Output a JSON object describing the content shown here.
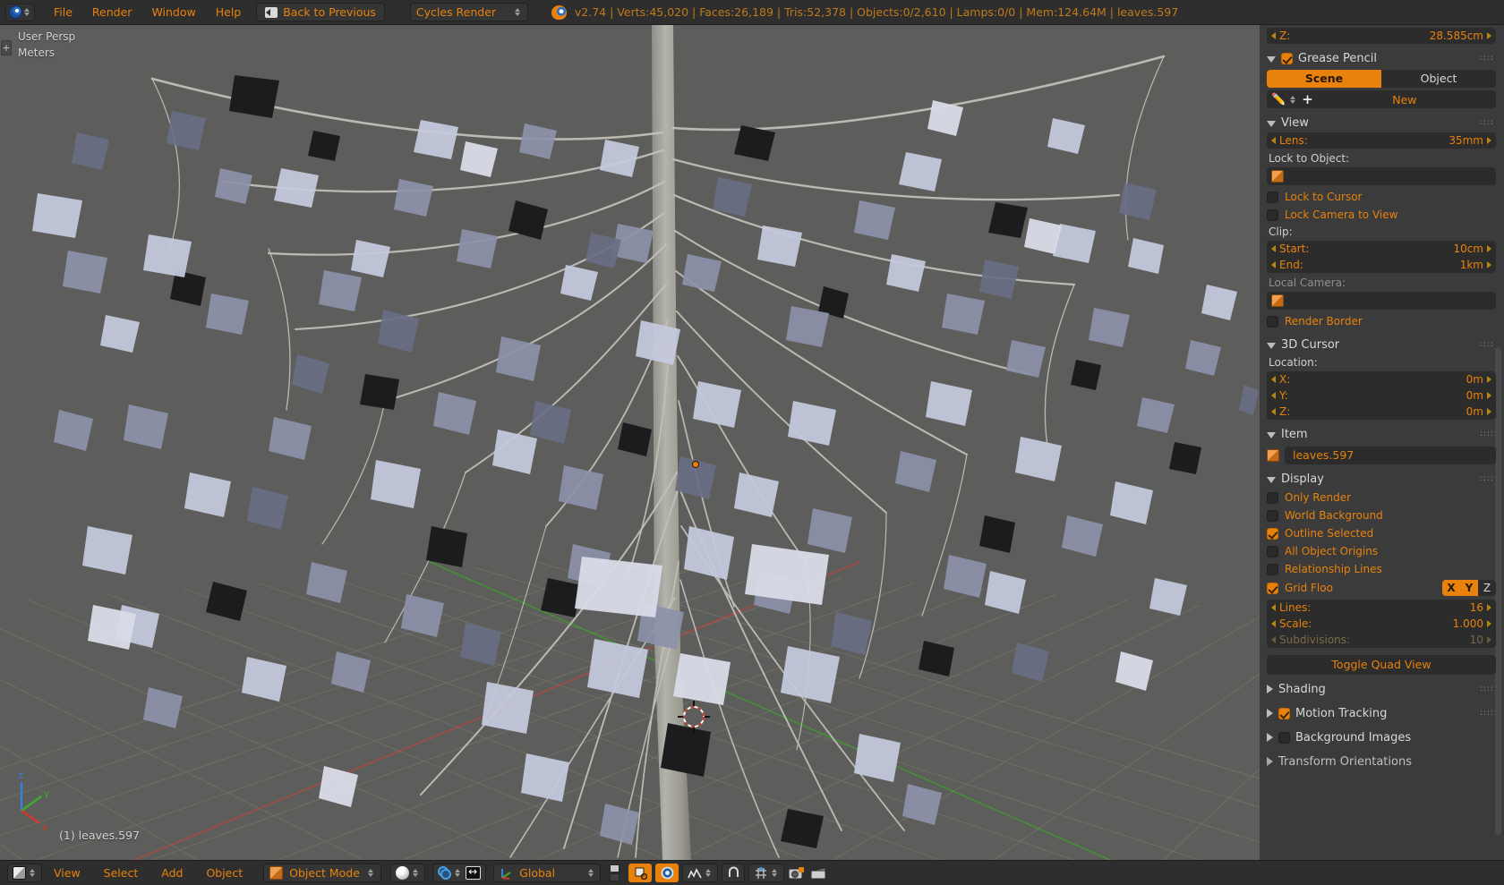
{
  "topbar": {
    "editor_icon": "blender-info-icon",
    "menus": [
      "File",
      "Render",
      "Window",
      "Help"
    ],
    "back_button": "Back to Previous",
    "render_engine": "Cycles Render",
    "stats": "v2.74 | Verts:45,020 | Faces:26,189 | Tris:52,378 | Objects:0/2,610 | Lamps:0/0 | Mem:124.64M | leaves.597",
    "version": "v2.74",
    "verts": "45,020",
    "faces": "26,189",
    "tris": "52,378",
    "objects": "0/2,610",
    "lamps": "0/0",
    "mem": "124.64M",
    "active_object": "leaves.597"
  },
  "viewport": {
    "view_name": "User Persp",
    "units": "Meters",
    "object_label": "(1) leaves.597",
    "axis_labels": {
      "x": "x",
      "y": "y",
      "z": "z"
    },
    "bg_color": "#5d5d5b",
    "grid_color": "#6e6d64",
    "x_axis_color": "#c7453c",
    "y_axis_color": "#4aa832",
    "cursor_color": "#ffffff"
  },
  "sidebar": {
    "transform_z": {
      "label": "Z:",
      "value": "28.585cm"
    },
    "grease_pencil": {
      "title": "Grease Pencil",
      "enabled": true,
      "tabs": [
        "Scene",
        "Object"
      ],
      "active_tab": "Scene",
      "new_button": "New"
    },
    "view": {
      "title": "View",
      "lens": {
        "label": "Lens:",
        "value": "35mm"
      },
      "lock_to_object_label": "Lock to Object:",
      "lock_to_object_value": "",
      "lock_to_cursor": {
        "label": "Lock to Cursor",
        "checked": false
      },
      "lock_camera_to_view": {
        "label": "Lock Camera to View",
        "checked": false
      },
      "clip_label": "Clip:",
      "clip_start": {
        "label": "Start:",
        "value": "10cm"
      },
      "clip_end": {
        "label": "End:",
        "value": "1km"
      },
      "local_camera_label": "Local Camera:",
      "local_camera_value": "",
      "render_border": {
        "label": "Render Border",
        "checked": false
      }
    },
    "cursor": {
      "title": "3D Cursor",
      "location_label": "Location:",
      "x": {
        "label": "X:",
        "value": "0m"
      },
      "y": {
        "label": "Y:",
        "value": "0m"
      },
      "z": {
        "label": "Z:",
        "value": "0m"
      }
    },
    "item": {
      "title": "Item",
      "name": "leaves.597"
    },
    "display": {
      "title": "Display",
      "only_render": {
        "label": "Only Render",
        "checked": false
      },
      "world_background": {
        "label": "World Background",
        "checked": false
      },
      "outline_selected": {
        "label": "Outline Selected",
        "checked": true
      },
      "all_object_origins": {
        "label": "All Object Origins",
        "checked": false
      },
      "relationship_lines": {
        "label": "Relationship Lines",
        "checked": false
      },
      "grid_floor": {
        "label": "Grid Floo",
        "checked": true
      },
      "axis_x": {
        "label": "X",
        "on": true
      },
      "axis_y": {
        "label": "Y",
        "on": true
      },
      "axis_z": {
        "label": "Z",
        "on": false
      },
      "lines": {
        "label": "Lines:",
        "value": "16"
      },
      "scale": {
        "label": "Scale:",
        "value": "1.000"
      },
      "subdivisions": {
        "label": "Subdivisions:",
        "value": "10"
      },
      "toggle_quad_view": "Toggle Quad View"
    },
    "collapsed": [
      {
        "title": "Shading",
        "has_checkbox": false,
        "checked": false
      },
      {
        "title": "Motion Tracking",
        "has_checkbox": true,
        "checked": true
      },
      {
        "title": "Background Images",
        "has_checkbox": true,
        "checked": false
      },
      {
        "title": "Transform Orientations",
        "has_checkbox": false,
        "checked": false
      }
    ]
  },
  "bottombar": {
    "editor_icon": "object-mode-editor-icon",
    "menus": [
      "View",
      "Select",
      "Add",
      "Object"
    ],
    "mode": "Object Mode",
    "shading": "solid-shading-icon",
    "snap": "snap-magnet-icon",
    "pivot": "pivot-center-icon",
    "orientation": "Global",
    "layers": "layer-grid",
    "manipulator_icons": [
      "translate-manipulator-icon",
      "rotate-manipulator-icon"
    ],
    "extra_icons": [
      "curve-icon",
      "snap-during-transform-icon",
      "proportional-edit-icon",
      "render-camera-icon",
      "render-animation-icon"
    ]
  },
  "accent_colors": {
    "orange": "#e8820c",
    "text_orange": "#d08a20",
    "panel_bg": "#3b3b3b",
    "field_bg": "#2c2c2c",
    "bar_bg": "#2e2e2e"
  }
}
